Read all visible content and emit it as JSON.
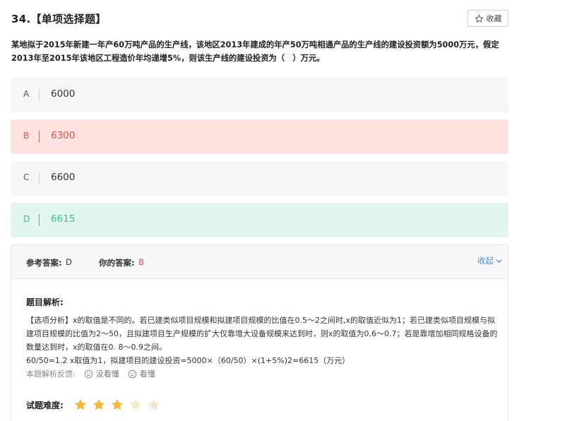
{
  "question": {
    "number_title": "34.【单项选择题】",
    "favorite_label": "收藏",
    "stem": "某地拟于2015年新建一年产60万吨产品的生产线，该地区2013年建成的年产50万吨相通产品的生产线的建设投资额为5000万元，假定2013年至2015年该地区工程造价年均递增5%，则该生产线的建设投资为（　）万元。"
  },
  "options": [
    {
      "letter": "A",
      "text": "6000",
      "state": "normal"
    },
    {
      "letter": "B",
      "text": "6300",
      "state": "wrong"
    },
    {
      "letter": "C",
      "text": "6600",
      "state": "normal"
    },
    {
      "letter": "D",
      "text": "6615",
      "state": "correct"
    }
  ],
  "answer": {
    "reference_label": "参考答案:",
    "reference_value": "D",
    "yours_label": "你的答案:",
    "yours_value": "B",
    "collapse_label": "收起"
  },
  "analysis": {
    "title": "题目解析:",
    "line1": "【选项分析】x的取值是不同的。若已建类似项目规模和拟建项目规模的比值在0.5～2之间时,x的取值近似为1；若已建类似项目规模与拟建项目规模的比值为2～50，且拟建项目生产规模的扩大仅靠增大设备规模来达到时，则x的取值为0.6～0.7；若是靠增加相同规格设备的数量达到时，x的取值在0. 8～0.9之间。",
    "line2": "60/50=1.2 x取值为1，拟建项目的建设投资=5000×（60/50）×(1+5%)2=6615（万元）"
  },
  "feedback": {
    "label": "本题解析反馈:",
    "not_understood": "没看懂",
    "understood": "看懂"
  },
  "difficulty": {
    "label": "试题难度:",
    "rating": 3,
    "max": 5
  },
  "colors": {
    "wrong": "#e8544e",
    "correct": "#3ebd93",
    "link": "#4a90e2",
    "star_on": "#f5b83d",
    "star_off": "#f3e6c8"
  }
}
